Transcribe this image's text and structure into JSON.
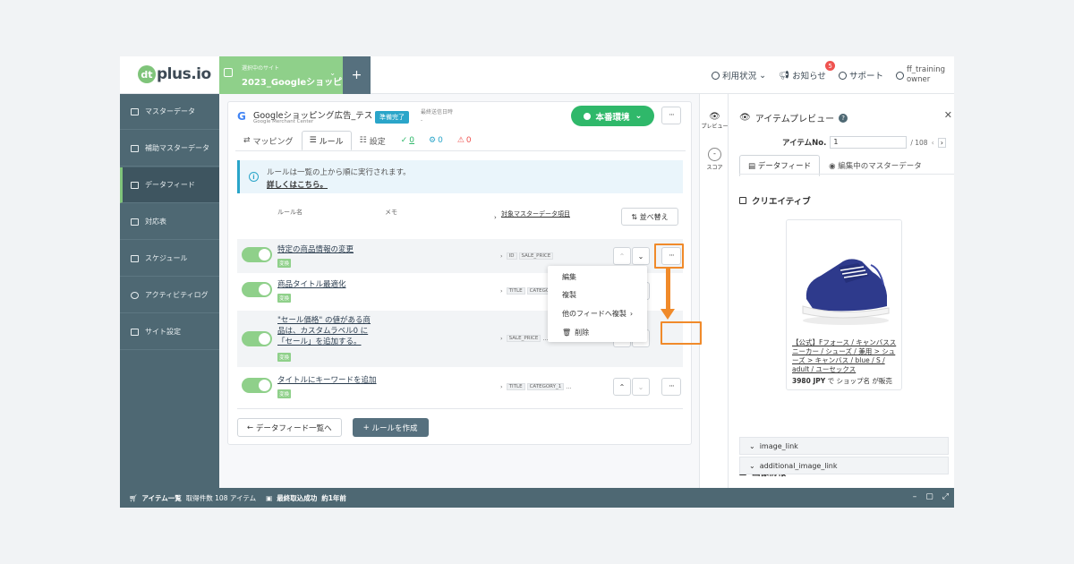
{
  "logo": {
    "text": "plus.io",
    "mark": "dt"
  },
  "site": {
    "label": "選択中のサイト",
    "name": "2023_Googleショッピ"
  },
  "top_nav": {
    "usage": "利用状況",
    "notices": "お知らせ",
    "notice_count": "5",
    "support": "サポート",
    "user_name": "ff_training",
    "user_role": "owner"
  },
  "sidebar": {
    "items": [
      {
        "label": "マスターデータ"
      },
      {
        "label": "補助マスターデータ"
      },
      {
        "label": "データフィード"
      },
      {
        "label": "対応表"
      },
      {
        "label": "スケジュール"
      },
      {
        "label": "アクティビティログ"
      },
      {
        "label": "サイト設定"
      }
    ]
  },
  "feed": {
    "title": "Googleショッピング広告_テスト",
    "subtitle": "Google Merchant Center",
    "status_badge": "準備完了",
    "last_sent_label": "最終送信日時",
    "last_sent_value": "-",
    "env_button": "本番環境",
    "tabs": [
      "マッピング",
      "ルール",
      "設定"
    ],
    "counts": {
      "ok": "0",
      "warn": "0",
      "error": "0"
    }
  },
  "info": {
    "text": "ルールは一覧の上から順に実行されます。",
    "link": "詳しくはこちら。"
  },
  "columns": {
    "rule_name": "ルール名",
    "memo": "メモ",
    "target": "対象マスターデータ項目"
  },
  "sort_button": "並べ替え",
  "rules": [
    {
      "name": "特定の商品情報の変更",
      "tag": "変換",
      "chips": [
        "ID",
        "SALE_PRICE"
      ],
      "more": ""
    },
    {
      "name": "商品タイトル最適化",
      "tag": "変換",
      "chips": [
        "TITLE",
        "CATEGORY_1"
      ],
      "more": "..."
    },
    {
      "name_lines": [
        "\"セール価格\" の値がある商",
        "品は、カスタムラベル0 に",
        "「セール」を追加する。"
      ],
      "tag": "変換",
      "chips": [
        "SALE_PRICE"
      ],
      "more": "..."
    },
    {
      "name": "タイトルにキーワードを追加",
      "tag": "変換",
      "chips": [
        "TITLE",
        "CATEGORY_1"
      ],
      "more": "..."
    }
  ],
  "context_menu": [
    "編集",
    "複製",
    "他のフィードへ複製",
    "削除"
  ],
  "footer": {
    "back": "データフィード一覧へ",
    "create": "ルールを作成"
  },
  "statusbar": {
    "items_label": "アイテム一覧",
    "count_text": "取得件数 108 アイテム",
    "fetch_label": "最終取込成功",
    "fetch_value": "約1年前"
  },
  "right_side": {
    "preview": "プレビュー",
    "score": "スコア"
  },
  "preview": {
    "title": "アイテムプレビュー",
    "item_no_label": "アイテムNo.",
    "item_no_value": "1",
    "item_total": "/ 108",
    "tabs": [
      "データフィード",
      "編集中のマスターデータ"
    ],
    "creative_heading": "クリエイティブ",
    "product_title": "【公式】Fフォース / キャンバススニーカー / シューズ / 兼用 > シューズ > キャンバス / blue / S / adult / ユーセックス",
    "price": "3980 JPY",
    "shop_text": "で ショップ名 が販売",
    "image_heading": "画像情報",
    "image_fields": [
      "image_link",
      "additional_image_link"
    ]
  },
  "colors": {
    "accent_green": "#7fc47a",
    "sidebar_bg": "#4e6873",
    "highlight_orange": "#f08a2a",
    "env_green": "#2fb86a"
  }
}
